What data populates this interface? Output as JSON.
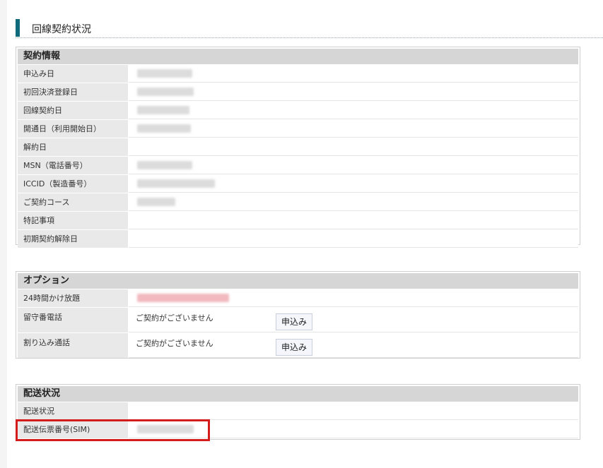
{
  "page": {
    "title": "回線契約状況"
  },
  "contract": {
    "header": "契約情報",
    "rows": [
      {
        "label": "申込み日"
      },
      {
        "label": "初回決済登録日"
      },
      {
        "label": "回線契約日"
      },
      {
        "label": "開通日（利用開始日）"
      },
      {
        "label": "解約日"
      },
      {
        "label": "MSN（電話番号）"
      },
      {
        "label": "ICCID（製造番号）"
      },
      {
        "label": "ご契約コース"
      },
      {
        "label": "特記事項"
      },
      {
        "label": "初期契約解除日"
      }
    ]
  },
  "options": {
    "header": "オプション",
    "rows": [
      {
        "label": "24時間かけ放題"
      },
      {
        "label": "留守番電話",
        "status": "ご契約がございません",
        "button": "申込み"
      },
      {
        "label": "割り込み通話",
        "status": "ご契約がございません",
        "button": "申込み"
      }
    ]
  },
  "delivery": {
    "header": "配送状況",
    "rows": [
      {
        "label": "配送状況"
      },
      {
        "label": "配送伝票番号(SIM)"
      }
    ]
  },
  "colors": {
    "accent": "#0f6a7c",
    "highlight": "#d41c1c",
    "header_bg": "#d6d6d6",
    "label_bg": "#e9e9e9"
  }
}
